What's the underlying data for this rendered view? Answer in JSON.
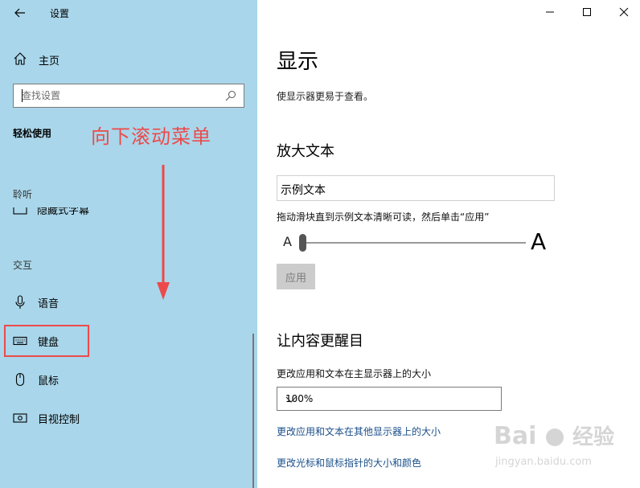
{
  "app": {
    "title": "设置"
  },
  "sidebar": {
    "home_label": "主页",
    "search_placeholder": "查找设置",
    "section_title": "轻松使用",
    "groups": [
      {
        "label": "聆听"
      },
      {
        "label": "交互"
      }
    ],
    "cut_item_label": "隐藏式字幕",
    "items": [
      {
        "label": "语音",
        "icon": "microphone-icon"
      },
      {
        "label": "键盘",
        "icon": "keyboard-icon"
      },
      {
        "label": "鼠标",
        "icon": "mouse-icon"
      },
      {
        "label": "目视控制",
        "icon": "eye-control-icon"
      }
    ]
  },
  "annotation": {
    "text": "向下滚动菜单",
    "color": "#ec4a4a"
  },
  "main": {
    "title": "显示",
    "description": "使显示器更易于查看。",
    "enlarge_text": {
      "heading": "放大文本",
      "sample": "示例文本",
      "hint": "拖动滑块直到示例文本清晰可读，然后单击“应用”",
      "small_a": "A",
      "large_a": "A",
      "slider_value": 0,
      "apply_label": "应用"
    },
    "brighter": {
      "heading": "让内容更醒目",
      "scale_label": "更改应用和文本在主显示器上的大小",
      "scale_value": "100%",
      "link1": "更改应用和文本在其他显示器上的大小",
      "link2": "更改光标和鼠标指针的大小和颜色"
    }
  },
  "watermark": {
    "brand": "Bai",
    "brand2": "经验",
    "url": "jingyan.baidu.com"
  },
  "colors": {
    "sidebar_bg": "#a9d6ea",
    "accent_red": "#ec4a4a",
    "link": "#1a4f8a"
  }
}
